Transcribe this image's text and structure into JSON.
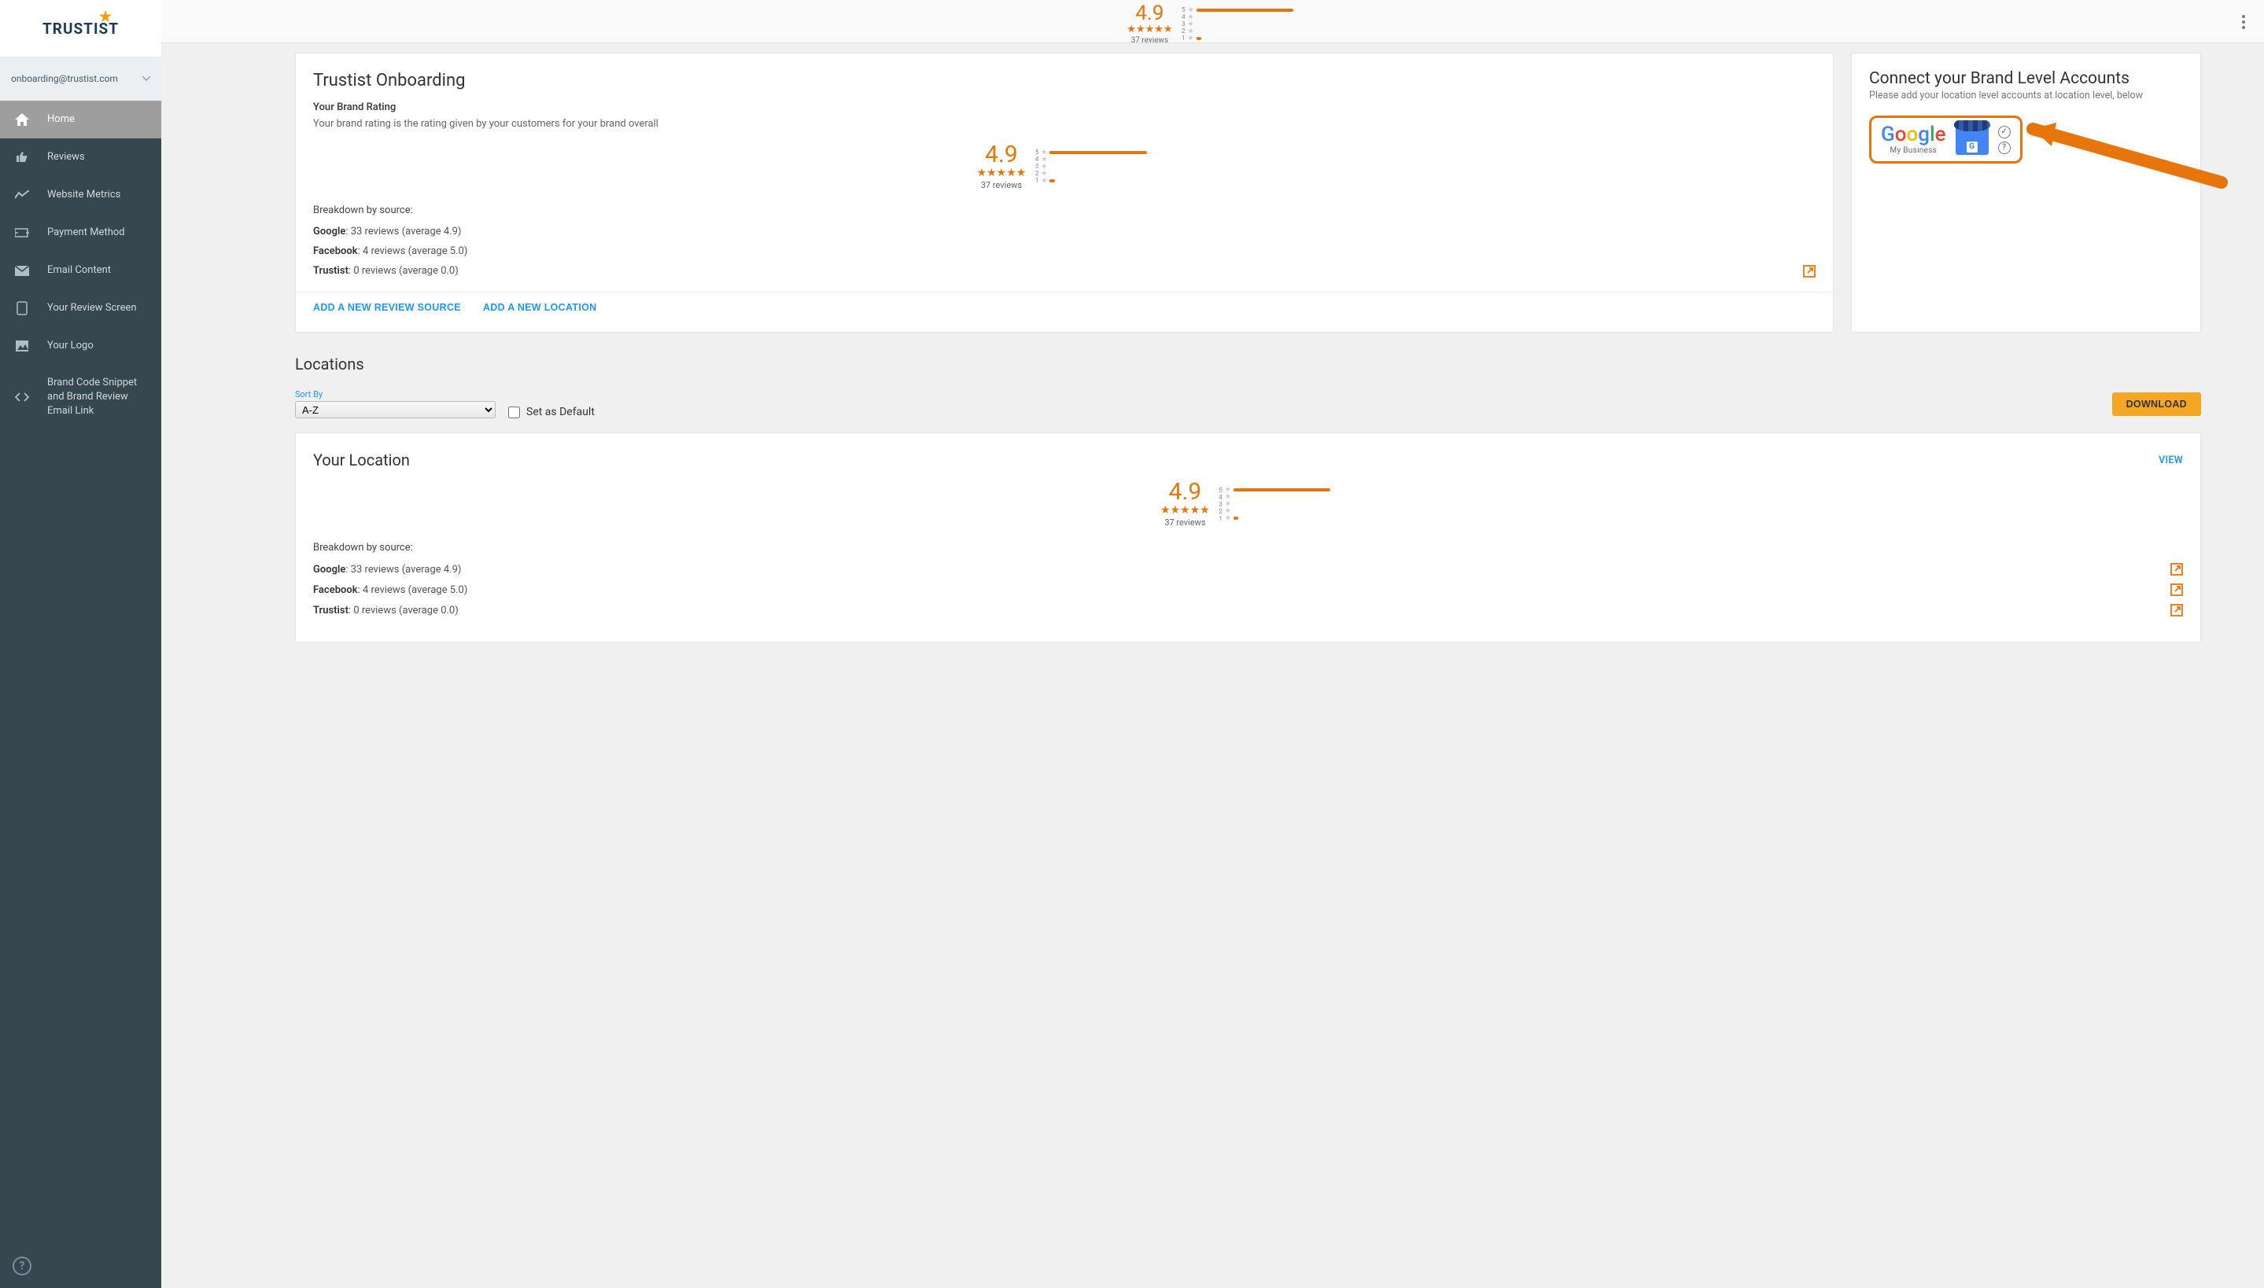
{
  "brand": "TRUSTIST",
  "user_email": "onboarding@trustist.com",
  "nav": [
    {
      "label": "Home",
      "active": true
    },
    {
      "label": "Reviews",
      "active": false
    },
    {
      "label": "Website Metrics",
      "active": false
    },
    {
      "label": "Payment Method",
      "active": false
    },
    {
      "label": "Email Content",
      "active": false
    },
    {
      "label": "Your Review Screen",
      "active": false
    },
    {
      "label": "Your Logo",
      "active": false
    },
    {
      "label": "Brand Code Snippet and Brand Review Email Link",
      "active": false
    }
  ],
  "rating": {
    "score": "4.9",
    "count_text": "37 reviews",
    "bars": [
      {
        "label": "5",
        "pct": 95
      },
      {
        "label": "4",
        "pct": 0
      },
      {
        "label": "3",
        "pct": 0
      },
      {
        "label": "2",
        "pct": 0
      },
      {
        "label": "1",
        "pct": 5
      }
    ]
  },
  "onboarding": {
    "title": "Trustist Onboarding",
    "section_label": "Your Brand Rating",
    "section_desc": "Your brand rating is the rating given by your customers for your brand overall",
    "breakdown_label": "Breakdown by source:",
    "sources": [
      {
        "name": "Google",
        "rest": ": 33 reviews (average 4.9)"
      },
      {
        "name": "Facebook",
        "rest": ": 4 reviews (average 5.0)"
      },
      {
        "name": "Trustist",
        "rest": ": 0 reviews (average 0.0)"
      }
    ],
    "action1": "ADD A NEW REVIEW SOURCE",
    "action2": "ADD A NEW LOCATION"
  },
  "connect": {
    "title": "Connect your Brand Level Accounts",
    "sub": "Please add your location level accounts at location level, below",
    "google_sub": "My Business"
  },
  "locations": {
    "header": "Locations",
    "sort_label": "Sort By",
    "sort_value": "A-Z",
    "default_label": "Set as Default",
    "download": "DOWNLOAD"
  },
  "your_location": {
    "title": "Your Location",
    "view": "VIEW",
    "breakdown_label": "Breakdown by source:",
    "sources": [
      {
        "name": "Google",
        "rest": ": 33 reviews (average 4.9)"
      },
      {
        "name": "Facebook",
        "rest": ": 4 reviews (average 5.0)"
      },
      {
        "name": "Trustist",
        "rest": ": 0 reviews (average 0.0)"
      }
    ]
  }
}
